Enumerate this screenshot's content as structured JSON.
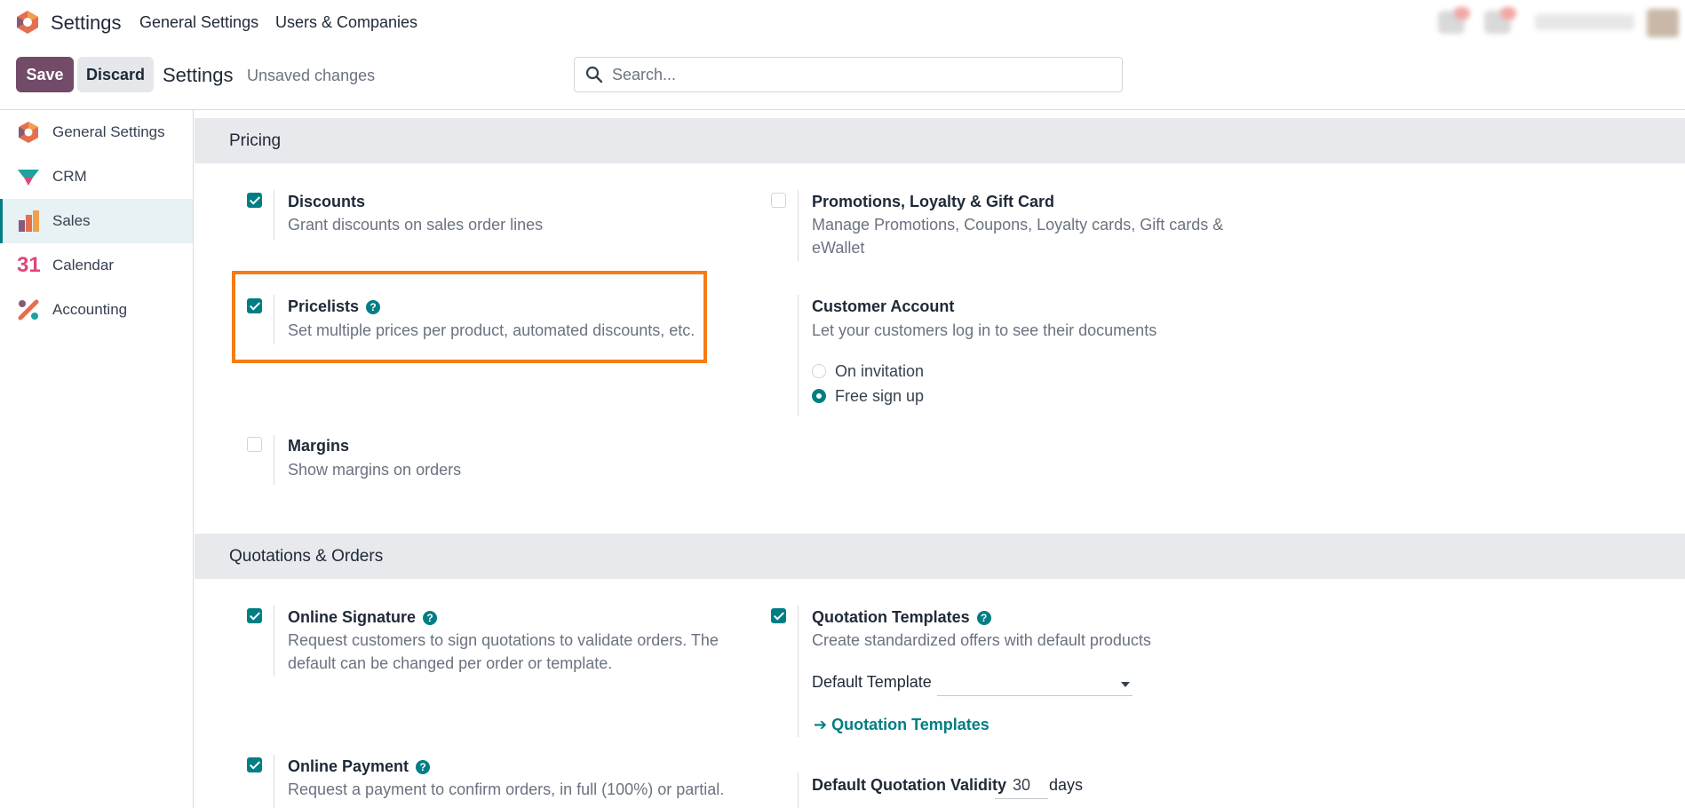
{
  "topbar": {
    "app_title": "Settings",
    "menu": [
      "General Settings",
      "Users & Companies"
    ]
  },
  "control_panel": {
    "save_label": "Save",
    "discard_label": "Discard",
    "title": "Settings",
    "status": "Unsaved changes",
    "search_placeholder": "Search..."
  },
  "sidebar": {
    "items": [
      {
        "label": "General Settings",
        "icon": "general-settings-icon"
      },
      {
        "label": "CRM",
        "icon": "crm-icon"
      },
      {
        "label": "Sales",
        "icon": "sales-icon",
        "active": true
      },
      {
        "label": "Calendar",
        "icon": "calendar-icon"
      },
      {
        "label": "Accounting",
        "icon": "accounting-icon"
      }
    ]
  },
  "calendar_icon_text": "31",
  "sections": {
    "pricing": {
      "title": "Pricing",
      "discounts": {
        "title": "Discounts",
        "desc": "Grant discounts on sales order lines",
        "checked": true
      },
      "promotions": {
        "title": "Promotions, Loyalty & Gift Card",
        "desc_line1": "Manage Promotions, Coupons, Loyalty cards, Gift cards &",
        "desc_line2": "eWallet",
        "checked": false
      },
      "pricelists": {
        "title": "Pricelists",
        "desc": "Set multiple prices per product, automated discounts, etc.",
        "checked": true
      },
      "customer_account": {
        "title": "Customer Account",
        "desc": "Let your customers log in to see their documents",
        "options": [
          "On invitation",
          "Free sign up"
        ],
        "selected": "Free sign up"
      },
      "margins": {
        "title": "Margins",
        "desc": "Show margins on orders",
        "checked": false
      }
    },
    "quotations": {
      "title": "Quotations & Orders",
      "online_signature": {
        "title": "Online Signature",
        "desc_line1": "Request customers to sign quotations to validate orders. The",
        "desc_line2": "default can be changed per order or template.",
        "checked": true
      },
      "quotation_templates": {
        "title": "Quotation Templates",
        "desc": "Create standardized offers with default products",
        "checked": true,
        "default_template_label": "Default Template",
        "default_template_value": "",
        "link": "Quotation Templates"
      },
      "online_payment": {
        "title": "Online Payment",
        "desc_line1": "Request a payment to confirm orders, in full (100%) or partial.",
        "checked": true
      },
      "quotation_validity": {
        "label": "Default Quotation Validity",
        "value": "30",
        "unit": "days"
      }
    }
  },
  "colors": {
    "primary": "#714b67",
    "accent": "#017e84",
    "highlight": "#f57c16",
    "section_bg": "#e7e9ed"
  }
}
